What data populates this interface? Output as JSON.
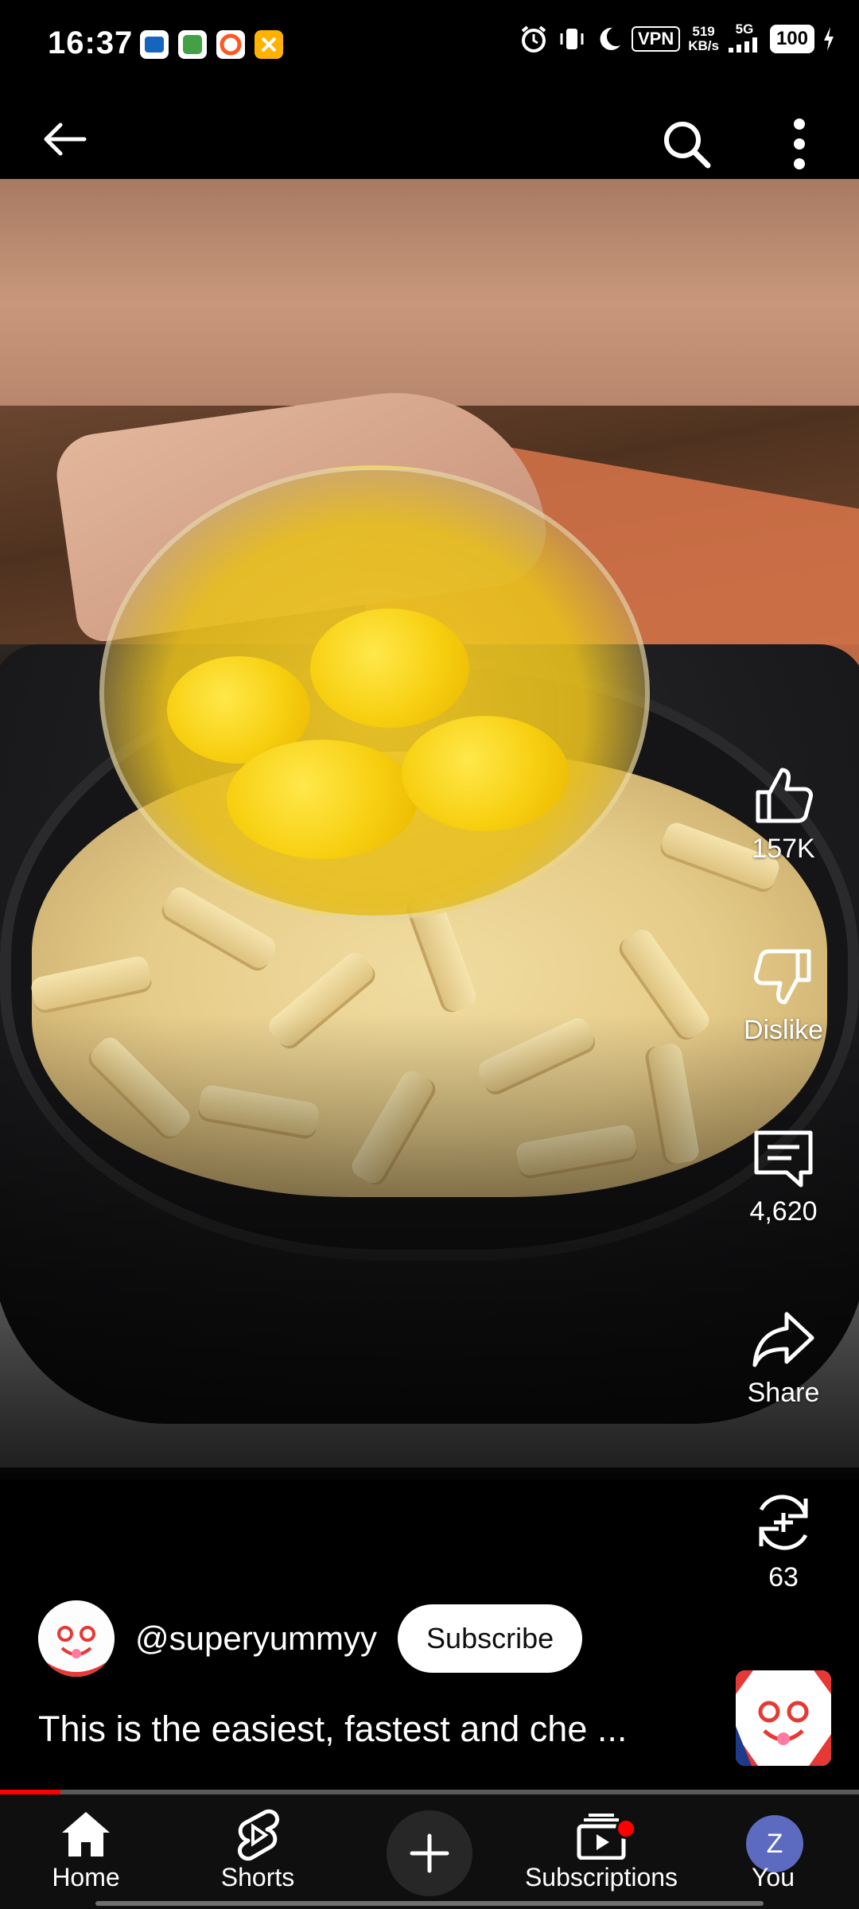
{
  "status_bar": {
    "time": "16:37",
    "vpn": "VPN",
    "speed_value": "519",
    "speed_unit": "KB/s",
    "network": "5G",
    "battery": "100"
  },
  "video": {
    "likes": "157K",
    "dislike_label": "Dislike",
    "comments": "4,620",
    "share_label": "Share",
    "remix_count": "63",
    "channel_handle": "@superyummyy",
    "subscribe_label": "Subscribe",
    "title": "This is the easiest, fastest and che ...",
    "progress_fraction": 0.07,
    "progress_color": "#ff0000"
  },
  "bottom_nav": {
    "items": [
      {
        "label": "Home",
        "icon": "home-icon"
      },
      {
        "label": "Shorts",
        "icon": "shorts-icon"
      },
      {
        "label": "",
        "icon": "plus-icon"
      },
      {
        "label": "Subscriptions",
        "icon": "subscriptions-icon"
      },
      {
        "label": "You",
        "icon": "avatar"
      }
    ],
    "you_initial": "Z"
  }
}
